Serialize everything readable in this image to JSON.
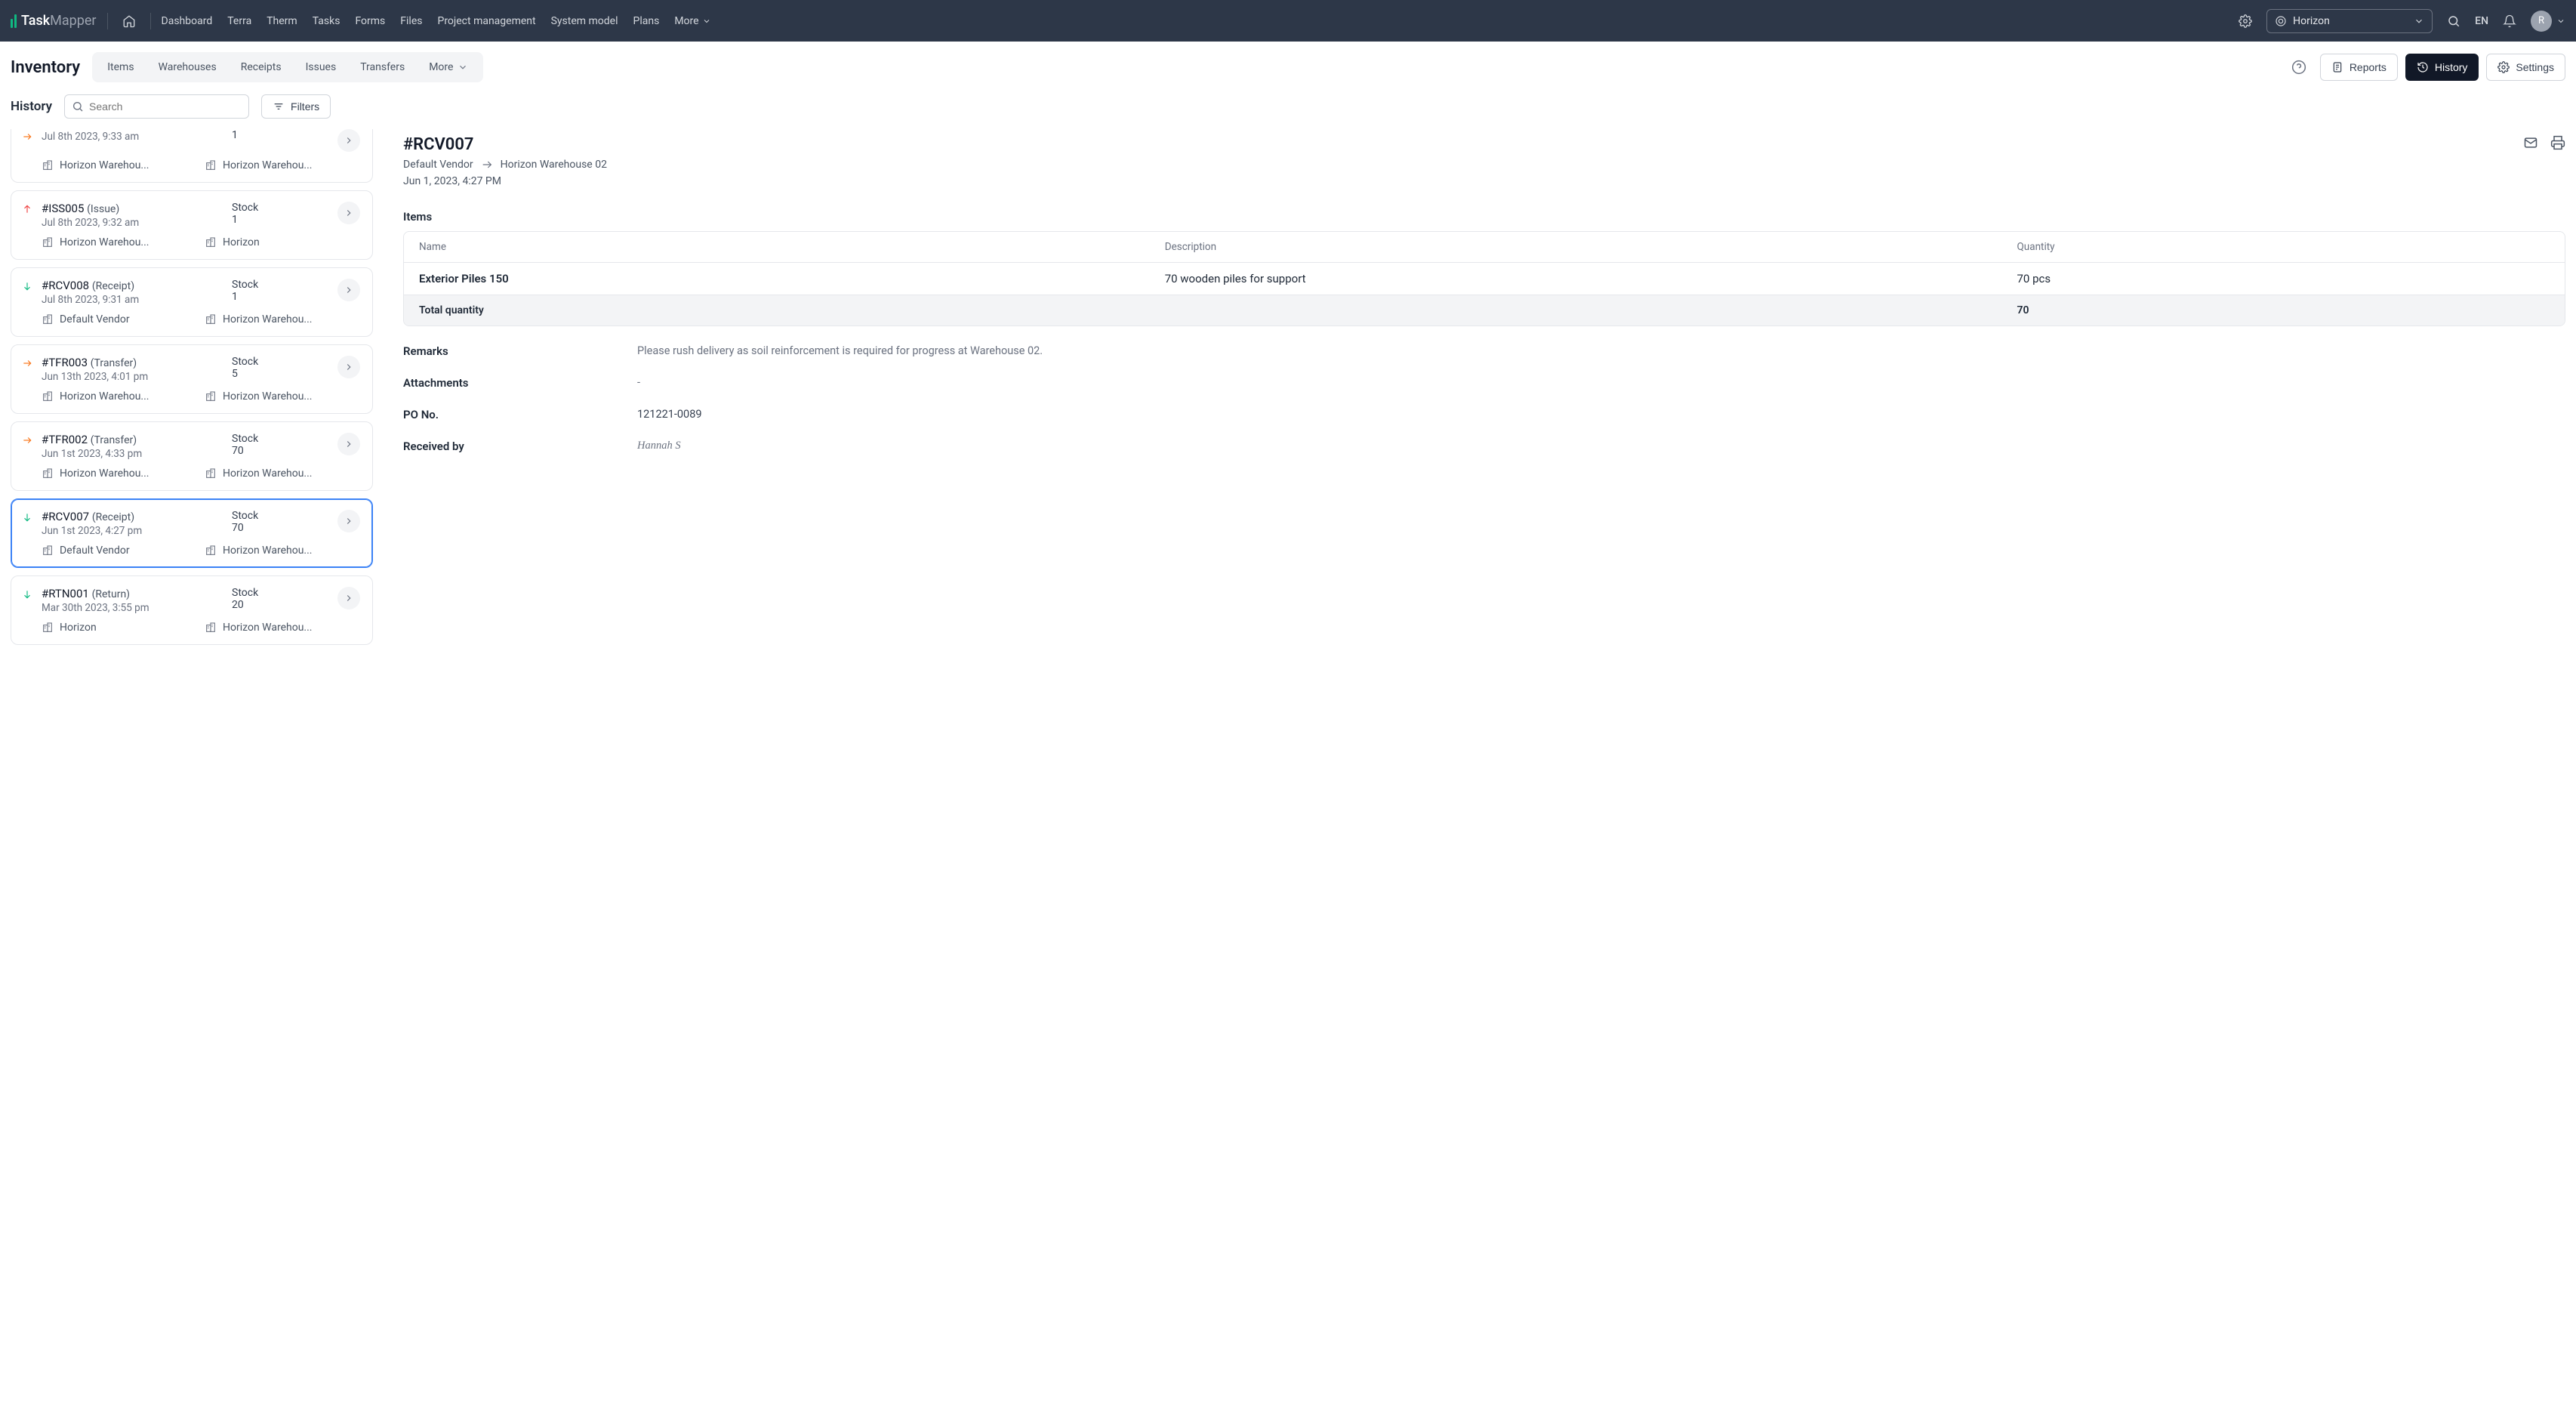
{
  "brand": {
    "name1": "Task",
    "name2": "Mapper"
  },
  "topnav": {
    "links": [
      "Dashboard",
      "Terra",
      "Therm",
      "Tasks",
      "Forms",
      "Files",
      "Project management",
      "System model",
      "Plans"
    ],
    "more": "More",
    "project": "Horizon",
    "lang": "EN",
    "avatar": "R"
  },
  "subheader": {
    "title": "Inventory",
    "tabs": [
      "Items",
      "Warehouses",
      "Receipts",
      "Issues",
      "Transfers"
    ],
    "more": "More",
    "reports": "Reports",
    "history": "History",
    "settings": "Settings"
  },
  "controls": {
    "title": "History",
    "search_placeholder": "Search",
    "filters": "Filters"
  },
  "list": [
    {
      "id": "partial-top",
      "kind": "transfer",
      "title": "",
      "type_label": "",
      "date": "Jul 8th 2023, 9:33 am",
      "stock_lbl": "",
      "stock": "1",
      "from": "Horizon Warehou...",
      "to": "Horizon Warehou...",
      "selected": false,
      "partial": true
    },
    {
      "id": "ISS005",
      "kind": "issue",
      "title": "#ISS005",
      "type_label": "(Issue)",
      "date": "Jul 8th 2023, 9:32 am",
      "stock_lbl": "Stock",
      "stock": "1",
      "from": "Horizon Warehou...",
      "to": "Horizon",
      "selected": false
    },
    {
      "id": "RCV008",
      "kind": "receipt",
      "title": "#RCV008",
      "type_label": "(Receipt)",
      "date": "Jul 8th 2023, 9:31 am",
      "stock_lbl": "Stock",
      "stock": "1",
      "from": "Default Vendor",
      "to": "Horizon Warehou...",
      "selected": false
    },
    {
      "id": "TFR003",
      "kind": "transfer",
      "title": "#TFR003",
      "type_label": "(Transfer)",
      "date": "Jun 13th 2023, 4:01 pm",
      "stock_lbl": "Stock",
      "stock": "5",
      "from": "Horizon Warehou...",
      "to": "Horizon Warehou...",
      "selected": false
    },
    {
      "id": "TFR002",
      "kind": "transfer",
      "title": "#TFR002",
      "type_label": "(Transfer)",
      "date": "Jun 1st 2023, 4:33 pm",
      "stock_lbl": "Stock",
      "stock": "70",
      "from": "Horizon Warehou...",
      "to": "Horizon Warehou...",
      "selected": false
    },
    {
      "id": "RCV007",
      "kind": "receipt",
      "title": "#RCV007",
      "type_label": "(Receipt)",
      "date": "Jun 1st 2023, 4:27 pm",
      "stock_lbl": "Stock",
      "stock": "70",
      "from": "Default Vendor",
      "to": "Horizon Warehou...",
      "selected": true
    },
    {
      "id": "RTN001",
      "kind": "return",
      "title": "#RTN001",
      "type_label": "(Return)",
      "date": "Mar 30th 2023, 3:55 pm",
      "stock_lbl": "Stock",
      "stock": "20",
      "from": "Horizon",
      "to": "Horizon Warehou...",
      "selected": false
    }
  ],
  "detail": {
    "title": "#RCV007",
    "from": "Default Vendor",
    "to": "Horizon Warehouse 02",
    "date": "Jun 1, 2023, 4:27 PM",
    "items_label": "Items",
    "table": {
      "headers": {
        "name": "Name",
        "desc": "Description",
        "qty": "Quantity"
      },
      "rows": [
        {
          "name": "Exterior Piles 150",
          "desc": "70 wooden piles for support",
          "qty": "70 pcs"
        }
      ],
      "total_label": "Total quantity",
      "total": "70"
    },
    "remarks_label": "Remarks",
    "remarks": "Please rush delivery as soil reinforcement is required for progress at Warehouse 02.",
    "attachments_label": "Attachments",
    "attachments": "-",
    "po_label": "PO No.",
    "po": "121221-0089",
    "received_label": "Received by",
    "received_by": "Hannah S"
  }
}
